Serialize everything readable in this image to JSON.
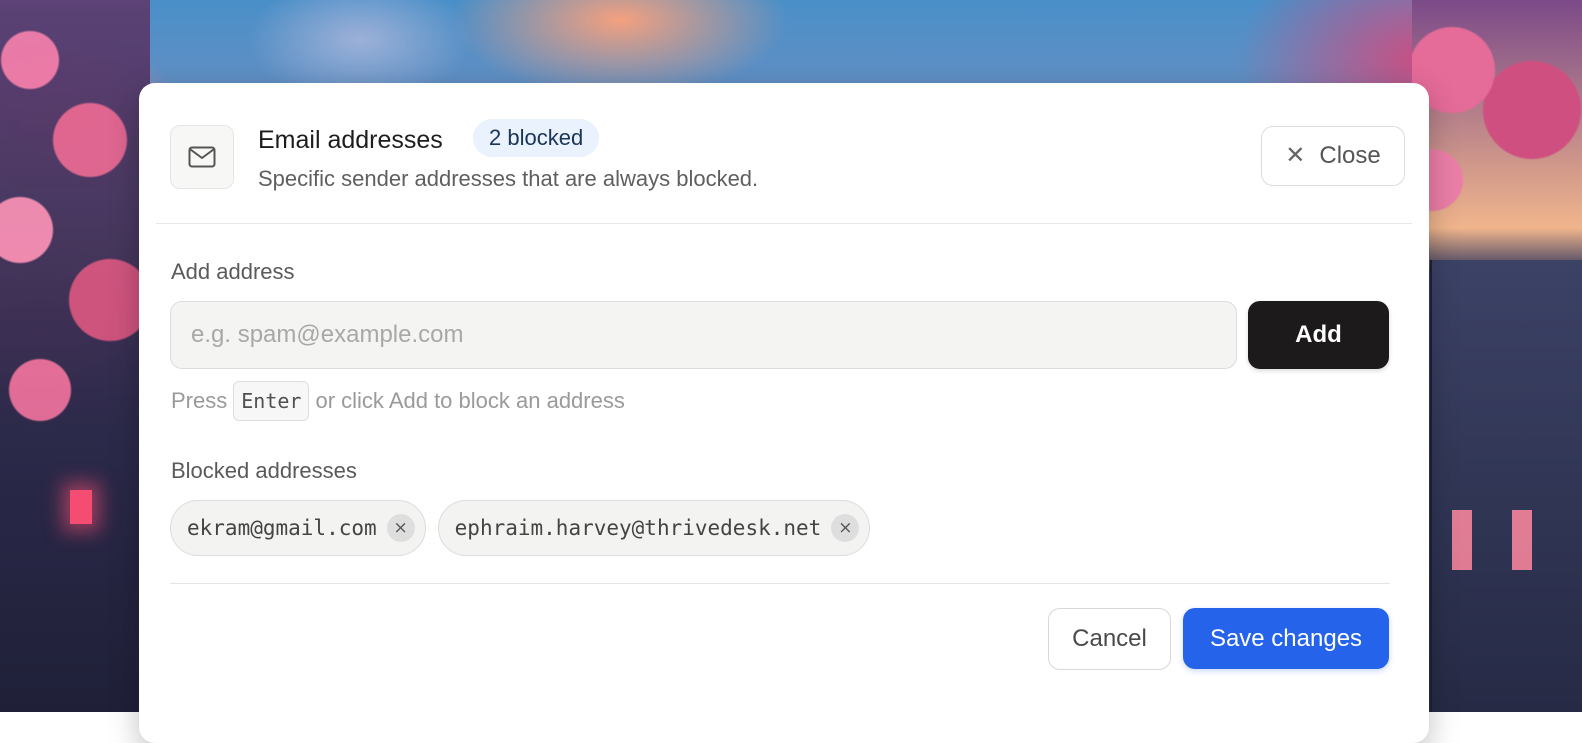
{
  "header": {
    "title": "Email addresses",
    "badge": "2 blocked",
    "subtitle": "Specific sender addresses that are always blocked.",
    "close_label": "Close"
  },
  "add_section": {
    "label": "Add address",
    "placeholder": "e.g. spam@example.com",
    "value": "",
    "button_label": "Add",
    "hint": {
      "prefix": "Press",
      "key": "Enter",
      "suffix": "or click Add to block an address"
    }
  },
  "blocked_section": {
    "label": "Blocked addresses",
    "items": [
      {
        "email": "ekram@gmail.com",
        "remove_glyph": "×"
      },
      {
        "email": "ephraim.harvey@thrivedesk.net",
        "remove_glyph": "×"
      }
    ]
  },
  "footer": {
    "cancel_label": "Cancel",
    "save_label": "Save changes"
  },
  "colors": {
    "primary": "#2563eb",
    "dark_button": "#1d1a1c",
    "badge_bg": "#e9f2fd"
  },
  "icons": {
    "header": "mail-icon",
    "close": "close-icon",
    "chip_remove": "remove-chip-icon"
  }
}
